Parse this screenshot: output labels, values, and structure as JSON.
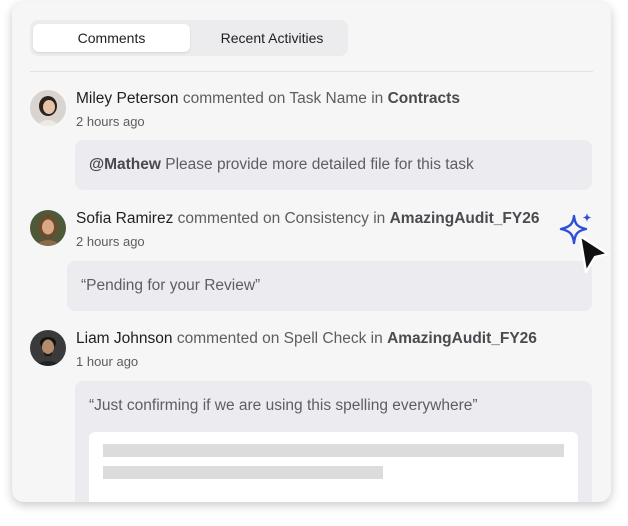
{
  "tabs": [
    {
      "label": "Comments",
      "active": true
    },
    {
      "label": "Recent Activities",
      "active": false
    }
  ],
  "comments": [
    {
      "author": "Miley Peterson",
      "action": "commented on Task Name in",
      "project": "Contracts",
      "time": "2 hours ago",
      "mention": "@Mathew",
      "text": "Please provide more detailed file for this task"
    },
    {
      "author": "Sofia Ramirez",
      "action": "commented on Consistency in",
      "project": "AmazingAudit_FY26",
      "time": "2 hours ago",
      "text": "“Pending for your Review”"
    },
    {
      "author": "Liam Johnson",
      "action": "commented on Spell Check in",
      "project": "AmazingAudit_FY26",
      "time": "1 hour ago",
      "text": "“Just confirming if we are using this spelling everywhere”"
    }
  ],
  "icons": {
    "sparkle": "sparkle-icon",
    "cursor": "pointer-cursor-icon"
  },
  "colors": {
    "accent_sparkle": "#2f4fd6",
    "panel_bg": "#f6f6f7",
    "bubble_bg": "#ebebf0"
  }
}
